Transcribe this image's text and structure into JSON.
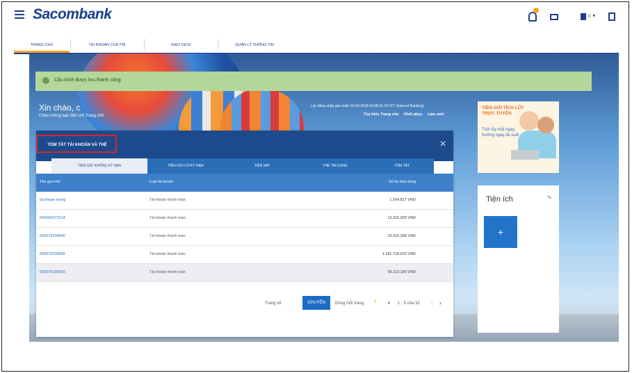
{
  "header": {
    "brand": "Sacombank",
    "user_label": "c ▾"
  },
  "nav": {
    "tabs": [
      "TRANG CHỦ",
      "TÀI KHOẢN CỦA TÔI",
      "GIAO DỊCH",
      "QUẢN LÝ THÔNG TIN"
    ]
  },
  "alert": {
    "message": "Cấu hình được lưu thành công"
  },
  "greeting": {
    "title": "Xin chào, c",
    "subtitle": "Chào mừng bạn đến với Trang chủ",
    "last_login": "Lần đăng nhập gần nhất: 03-04-2018 04:38:23 CH ICT (Internet Banking)",
    "links": [
      "Tùy biến Trang chủ",
      "Khôi phục",
      "Làm mới"
    ]
  },
  "panel": {
    "title": "TÓM TẮT TÀI KHOẢN VÀ THẺ",
    "tabs": [
      "TIỀN GỬI KHÔNG KỲ HẠN",
      "TIỀN GỬI CÓ KỲ HẠN",
      "TIỀN VAY",
      "THẺ TÍN DỤNG",
      "TÓM TẮT"
    ],
    "columns": [
      "Tên gợi nhớ",
      "Loại tài khoản",
      "Số dư khả dụng"
    ],
    "rows": [
      {
        "name": "tai khoan luong",
        "type": "Tài khoản thanh toán",
        "balance": "1.164.817 VND"
      },
      {
        "name": "040060272214",
        "type": "Tài khoản thanh toán",
        "balance": "13.315.929 VND"
      },
      {
        "name": "050079238640",
        "type": "Tài khoản thanh toán",
        "balance": "19.015.356 VND"
      },
      {
        "name": "050079238659",
        "type": "Tài khoản thanh toán",
        "balance": "1.181.718.910 VND"
      },
      {
        "name": "050079238993",
        "type": "Tài khoản thanh toán",
        "balance": "56.113.100 VND"
      }
    ],
    "pager": {
      "page_label": "Trang số",
      "go_button": "CHUYỂN",
      "per_page_label": "Dòng mỗi trang:",
      "per_page_value": "5",
      "range": "1 - 5 của 32"
    }
  },
  "ad": {
    "headline": "TIỀN GỬI TÍCH LŨY TRỰC TUYẾN",
    "tagline": "Tích lũy mỗi ngày, hưởng ngay lãi suất"
  },
  "utilities": {
    "title": "Tiện ích",
    "add": "+"
  }
}
